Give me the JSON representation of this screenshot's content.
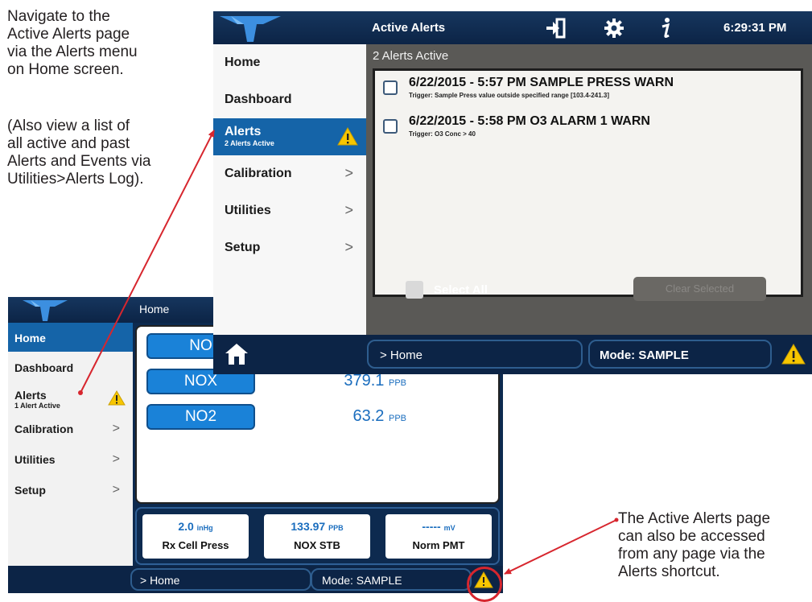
{
  "notes": {
    "top_left": [
      "Navigate to the",
      "Active Alerts page",
      "via the Alerts menu",
      "on Home screen."
    ],
    "top_left_2": [
      "(Also view a list of",
      "all active and past",
      "Alerts and Events via",
      "Utilities>Alerts Log)."
    ],
    "bottom_right": [
      "The Active Alerts page",
      "can also be accessed",
      "from any page via the",
      "Alerts shortcut."
    ]
  },
  "active_alerts_screen": {
    "title": "Active Alerts",
    "time": "6:29:31 PM",
    "sidebar": [
      {
        "label": "Home"
      },
      {
        "label": "Dashboard"
      },
      {
        "label": "Alerts",
        "sub": "2 Alerts Active",
        "warn": true
      },
      {
        "label": "Calibration",
        "chevron": ">"
      },
      {
        "label": "Utilities",
        "chevron": ">"
      },
      {
        "label": "Setup",
        "chevron": ">"
      }
    ],
    "alerts_count": "2 Alerts Active",
    "alerts": [
      {
        "title": "6/22/2015 - 5:57 PM SAMPLE PRESS WARN",
        "trigger": "Trigger: Sample Press value outside specified range [103.4-241.3]"
      },
      {
        "title": "6/22/2015 - 5:58 PM O3 ALARM 1 WARN",
        "trigger": "Trigger: O3 Conc > 40"
      }
    ],
    "select_all": "Select All",
    "clear_selected": "Clear Selected",
    "breadcrumb": "> Home",
    "mode": "Mode: SAMPLE"
  },
  "home_screen": {
    "title": "Home",
    "sidebar": [
      {
        "label": "Home"
      },
      {
        "label": "Dashboard"
      },
      {
        "label": "Alerts",
        "sub": "1 Alert Active",
        "warn": true
      },
      {
        "label": "Calibration",
        "chevron": ">"
      },
      {
        "label": "Utilities",
        "chevron": ">"
      },
      {
        "label": "Setup",
        "chevron": ">"
      }
    ],
    "gases": [
      {
        "name": "NO",
        "value": "",
        "unit": ""
      },
      {
        "name": "NOX",
        "value": "379.1",
        "unit": "PPB"
      },
      {
        "name": "NO2",
        "value": "63.2",
        "unit": "PPB"
      }
    ],
    "meters": [
      {
        "value": "2.0",
        "unit": "inHg",
        "label": "Rx Cell Press"
      },
      {
        "value": "133.97",
        "unit": "PPB",
        "label": "NOX STB"
      },
      {
        "value": "-----",
        "unit": "mV",
        "label": "Norm PMT"
      }
    ],
    "breadcrumb": "> Home",
    "mode": "Mode: SAMPLE"
  },
  "colors": {
    "navy": "#0c2446",
    "accent_blue": "#1564a8",
    "warning": "#f7c600",
    "callout_red": "#d7262e"
  },
  "icons": [
    "teledyne-logo-icon",
    "logout-icon",
    "gear-icon",
    "info-icon",
    "home-icon",
    "warning-icon",
    "checkbox-icon"
  ]
}
